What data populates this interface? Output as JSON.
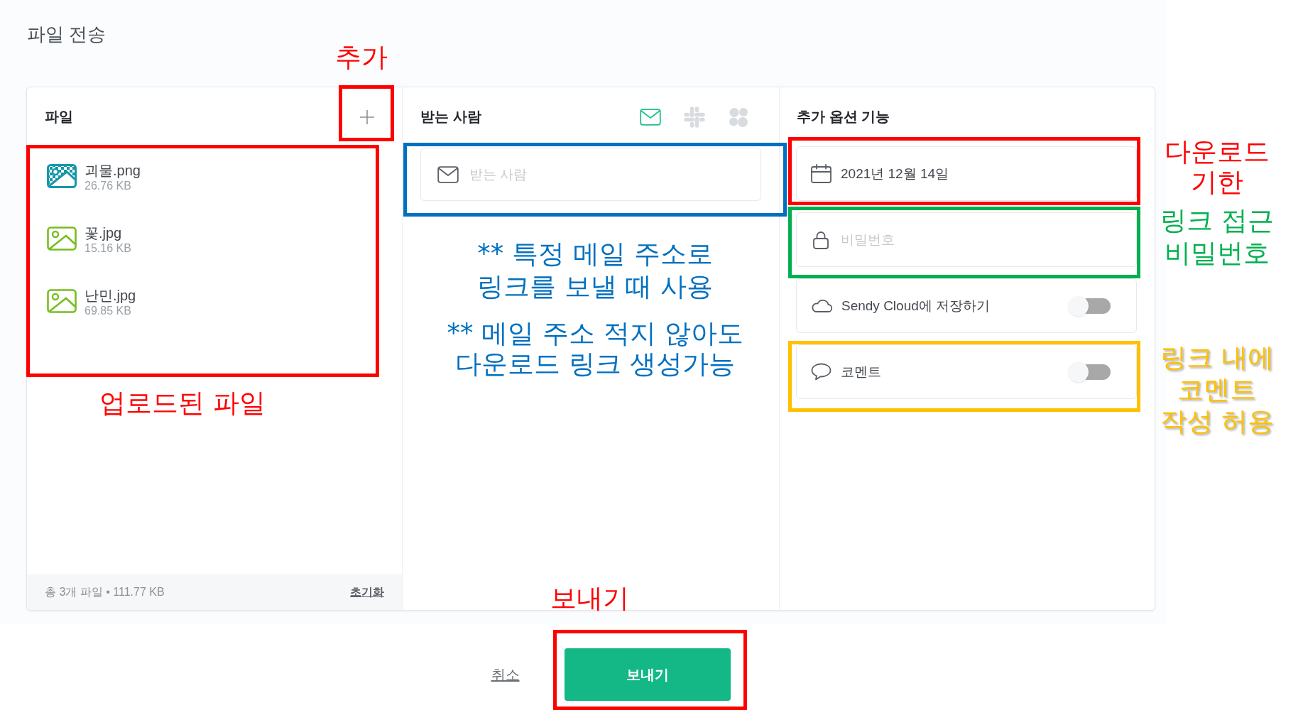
{
  "dialog": {
    "title": "파일 전송"
  },
  "files_panel": {
    "heading": "파일",
    "files": [
      {
        "kind": "png",
        "name": "괴물.png",
        "size": "26.76 KB"
      },
      {
        "kind": "jpg",
        "name": "꽃.jpg",
        "size": "15.16 KB"
      },
      {
        "kind": "jpg",
        "name": "난민.jpg",
        "size": "69.85 KB"
      }
    ],
    "summary": "총 3개 파일 • 111.77 KB",
    "reset_link": "초기화"
  },
  "recipients_panel": {
    "heading": "받는 사람",
    "channels": [
      {
        "kind": "mail",
        "selected": true
      },
      {
        "kind": "hash",
        "selected": false
      },
      {
        "kind": "clover",
        "selected": false
      }
    ],
    "recipient_field": {
      "placeholder": "받는 사람"
    }
  },
  "options_panel": {
    "heading": "추가 옵션 기능",
    "options": [
      {
        "kind": "date",
        "value": "2021년 12월 14일"
      },
      {
        "kind": "password",
        "placeholder": "비밀번호"
      },
      {
        "kind": "cloud",
        "label": "Sendy Cloud에 저장하기",
        "on": false
      },
      {
        "kind": "comment",
        "label": "코멘트",
        "on": false
      }
    ]
  },
  "actions": [
    {
      "kind": "link",
      "label": "취소"
    },
    {
      "kind": "primary",
      "label": "보내기"
    }
  ],
  "annotations": [
    {
      "color": "#ff0000",
      "lines": [
        "추가"
      ]
    },
    {
      "color": "#ff0000",
      "lines": [
        "업로드된 파일"
      ]
    },
    {
      "color": "#0070c0",
      "notes": [
        {
          "lines": [
            "** 특정 메일 주소로",
            "링크를 보낼 때 사용"
          ]
        },
        {
          "lines": [
            "** 메일 주소 적지 않아도",
            "다운로드 링크 생성가능"
          ]
        }
      ]
    },
    {
      "color": "#ff0000",
      "lines": [
        "다운로드",
        "기한"
      ]
    },
    {
      "color": "#00b050",
      "lines": [
        "링크 접근",
        "비밀번호"
      ]
    },
    {
      "color": "#ffc000",
      "lines": [
        "링크 내에",
        "코멘트",
        "작성 허용"
      ]
    },
    {
      "color": "#ff0000",
      "lines": [
        "보내기"
      ]
    }
  ]
}
